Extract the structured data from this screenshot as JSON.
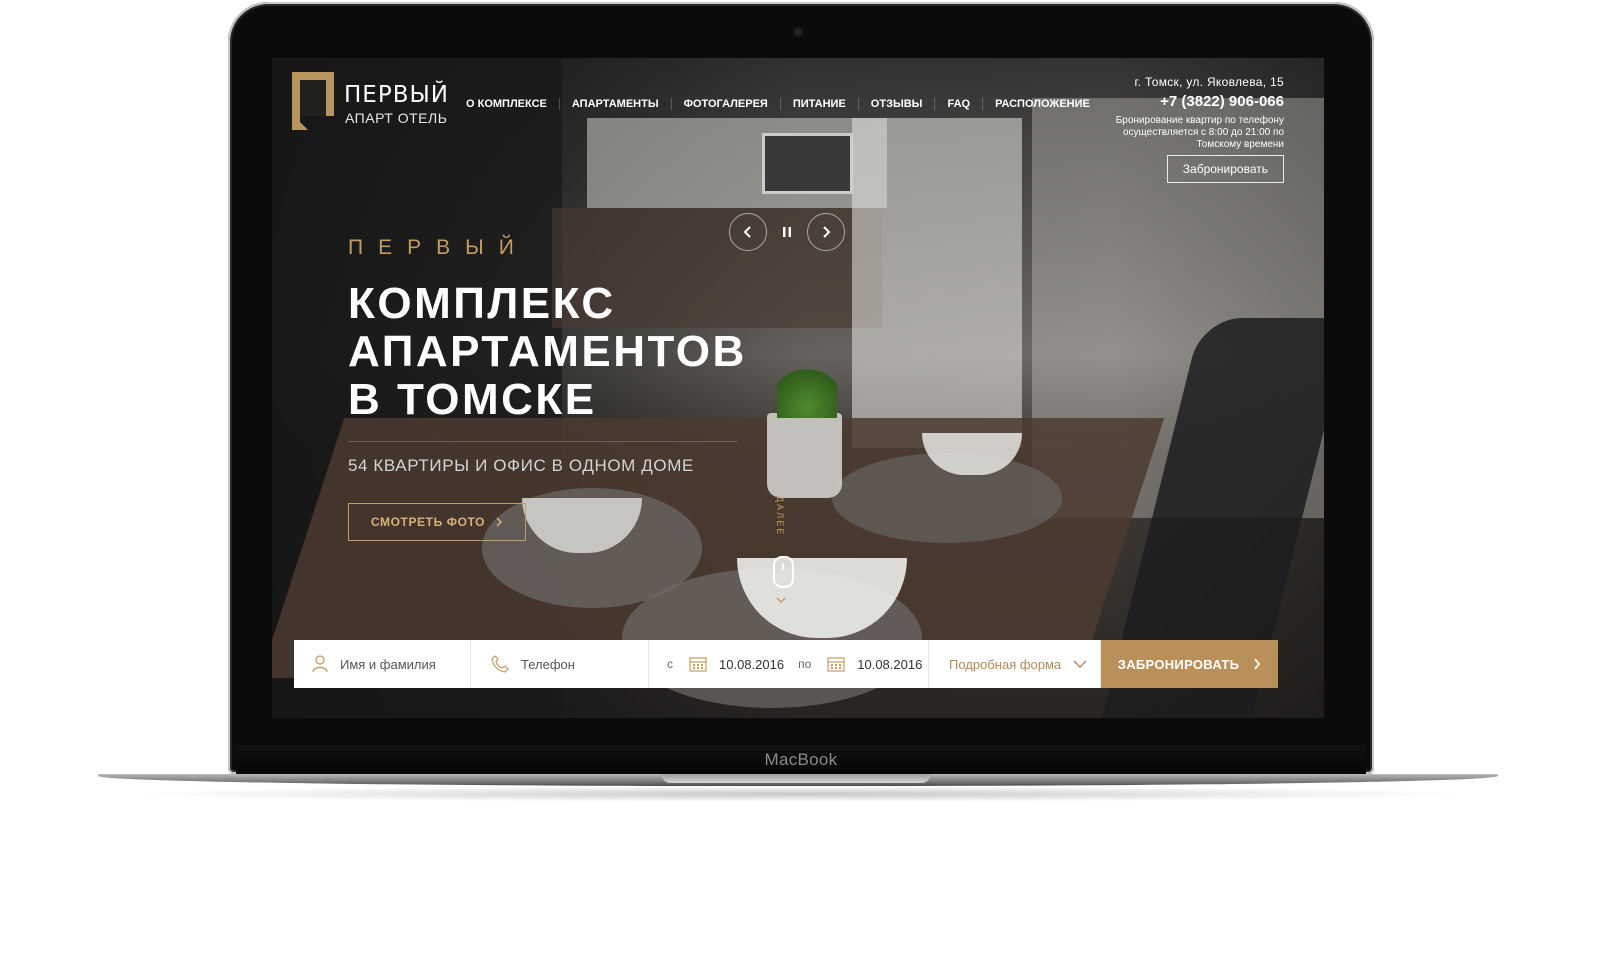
{
  "header": {
    "logo_title": "ПЕРВЫЙ",
    "logo_subtitle": "АПАРТ ОТЕЛЬ",
    "nav": [
      {
        "label": "О КОМПЛЕКСЕ"
      },
      {
        "label": "АПАРТАМЕНТЫ"
      },
      {
        "label": "ФОТОГАЛЕРЕЯ"
      },
      {
        "label": "ПИТАНИЕ"
      },
      {
        "label": "ОТЗЫВЫ"
      },
      {
        "label": "FAQ"
      },
      {
        "label": "РАСПОЛОЖЕНИЕ"
      }
    ],
    "address": "г. Томск, ул. Яковлева, 15",
    "phone": "+7 (3822) 906-066",
    "hours": "Бронирование квартир по телефону осуществляется с 8:00 до 21:00 по Томскому времени",
    "book_label": "Забронировать"
  },
  "hero": {
    "kicker": "ПЕРВЫЙ",
    "title": "КОМПЛЕКС\nАПАРТАМЕНТОВ\nВ ТОМСКЕ",
    "subtitle": "54 КВАРТИРЫ И ОФИС В ОДНОМ ДОМЕ",
    "cta_label": "СМОТРЕТЬ ФОТО",
    "scroll_label": "ДАЛЕЕ"
  },
  "booking": {
    "name_placeholder": "Имя и фамилия",
    "phone_placeholder": "Телефон",
    "from_label": "с",
    "from_date": "10.08.2016",
    "to_label": "по",
    "to_date": "10.08.2016",
    "more_label": "Подробная форма",
    "submit_label": "ЗАБРОНИРОВАТЬ"
  },
  "device": {
    "brand": "MacBook"
  },
  "colors": {
    "accent": "#c49b63",
    "submit_bg": "#b98f5a",
    "logo_gold": "#b8945f"
  },
  "icons": [
    "arrow-left-icon",
    "pause-icon",
    "arrow-right-icon",
    "user-icon",
    "phone-icon",
    "calendar-icon",
    "chevron-down-icon",
    "chevron-right-icon",
    "mouse-icon"
  ]
}
